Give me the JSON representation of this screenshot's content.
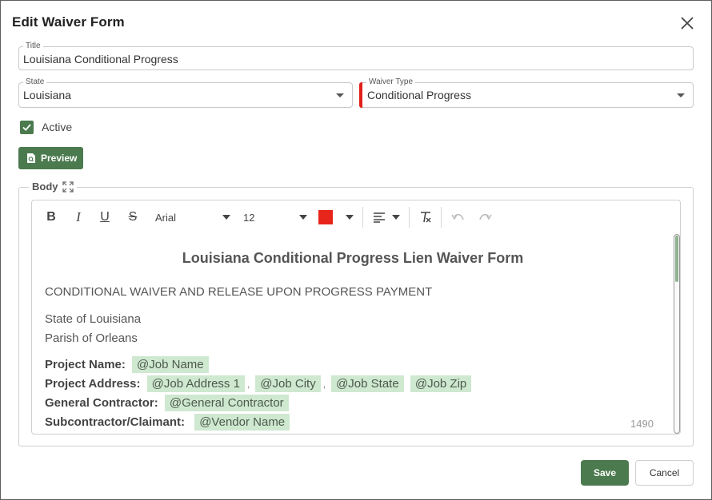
{
  "dialog": {
    "title": "Edit Waiver Form",
    "close_icon": "close-icon"
  },
  "form": {
    "title_label": "Title",
    "title_value": "Louisiana Conditional Progress",
    "state_label": "State",
    "state_value": "Louisiana",
    "waiver_type_label": "Waiver Type",
    "waiver_type_value": "Conditional Progress",
    "required_color": "#e0201b",
    "active_label": "Active",
    "active_checked": true,
    "preview_label": "Preview",
    "body_label": "Body"
  },
  "toolbar": {
    "bold": "B",
    "italic": "I",
    "underline": "U",
    "strike": "S",
    "font_family": "Arial",
    "font_size": "12",
    "text_color": "#e8251b"
  },
  "document": {
    "heading": "Louisiana Conditional Progress Lien Waiver Form",
    "subheading": "CONDITIONAL WAIVER AND RELEASE UPON PROGRESS PAYMENT",
    "state_line": "State of Louisiana",
    "parish_line": "Parish of Orleans",
    "project_name_label": "Project Name:",
    "project_name_tag": "@Job Name",
    "project_address_label": "Project Address:",
    "address_tag": "@Job Address 1",
    "city_tag": "@Job City",
    "state_tag": "@Job State",
    "zip_tag": "@Job Zip",
    "separator": ",",
    "gc_label": "General Contractor:",
    "gc_tag": "@General Contractor",
    "sub_label": "Subcontractor/Claimant:",
    "sub_tag": "@Vendor Name",
    "char_count": "1490"
  },
  "actions": {
    "save": "Save",
    "cancel": "Cancel"
  },
  "colors": {
    "accent": "#4b7a4e",
    "tag_bg": "#cfe8d0"
  }
}
